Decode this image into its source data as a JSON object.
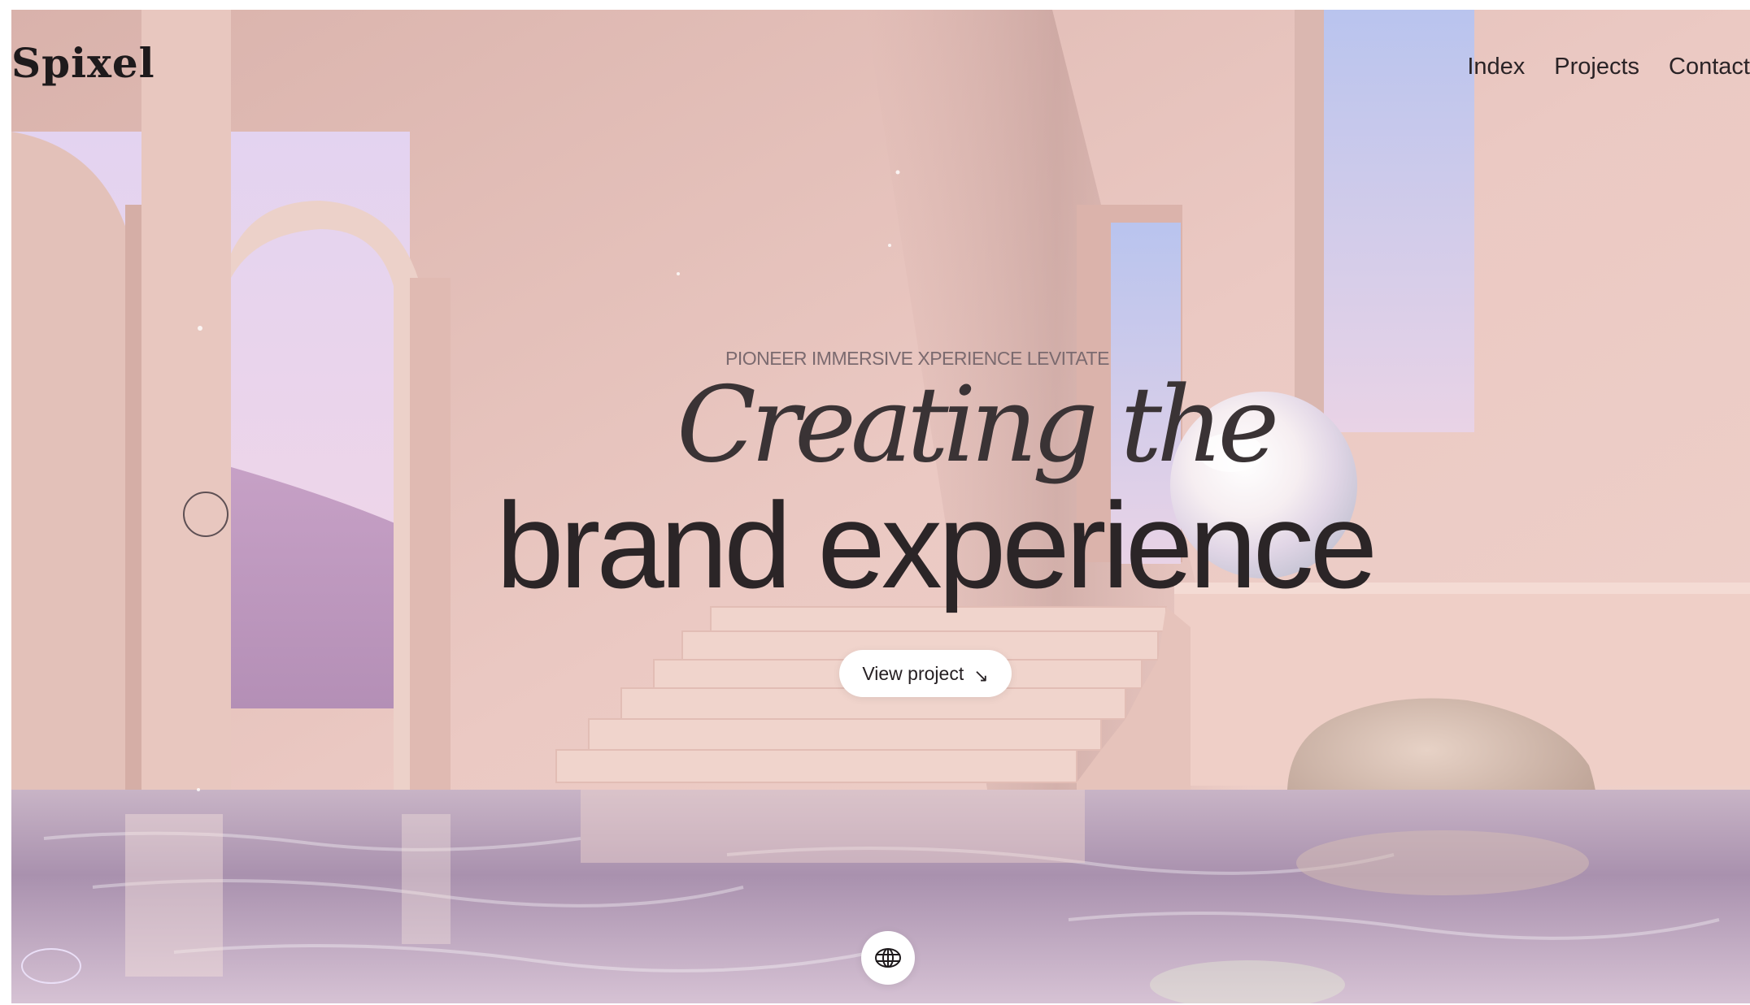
{
  "header": {
    "logo": "Spixel",
    "nav": [
      {
        "label": "Index"
      },
      {
        "label": "Projects"
      },
      {
        "label": "Contact"
      }
    ]
  },
  "hero": {
    "eyebrow": "PIONEER IMMERSIVE XPERIENCE LEVITATE",
    "title_line1": "Creating the",
    "title_line2": "brand experience",
    "cta": {
      "label": "View project",
      "icon": "arrow-down-right-icon"
    }
  },
  "footer": {
    "language_icon": "globe-icon",
    "sound_icon": "sound-toggle-icon"
  },
  "colors": {
    "wall": "#e9c6c0",
    "sky": "#dcd0f2",
    "water": "#b8a4c0",
    "text_dark": "#2b2527"
  }
}
